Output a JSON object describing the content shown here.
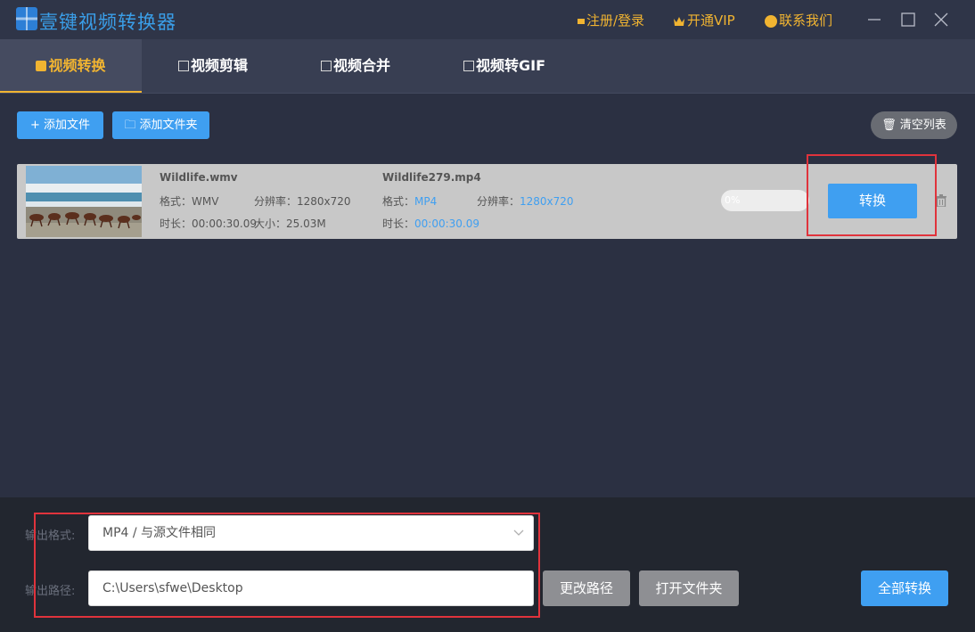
{
  "app": {
    "title": "壹键视频转换器"
  },
  "header": {
    "login": "注册/登录",
    "vip": "开通VIP",
    "contact": "联系我们"
  },
  "tabs": [
    {
      "label": "视频转换",
      "active": true
    },
    {
      "label": "视频剪辑",
      "active": false
    },
    {
      "label": "视频合并",
      "active": false
    },
    {
      "label": "视频转GIF",
      "active": false
    }
  ],
  "toolbar": {
    "add_file": "添加文件",
    "add_folder": "添加文件夹",
    "clear_list": "清空列表"
  },
  "files": [
    {
      "source": {
        "name": "Wildlife.wmv",
        "format_label": "格式：",
        "format": "WMV",
        "resolution_label": "分辨率：",
        "resolution": "1280x720",
        "duration_label": "时长：",
        "duration": "00:00:30.09",
        "size_label": "大小：",
        "size": "25.03M"
      },
      "output": {
        "name": "Wildlife279.mp4",
        "format_label": "格式：",
        "format": "MP4",
        "resolution_label": "分辨率：",
        "resolution": "1280x720",
        "duration_label": "时长：",
        "duration": "00:00:30.09"
      },
      "progress_text": "0%",
      "progress": 0,
      "convert_label": "转换"
    }
  ],
  "bottom": {
    "format_label": "输出格式:",
    "format_value": "MP4 / 与源文件相同",
    "path_label": "输出路径:",
    "path_value": "C:\\Users\\sfwe\\Desktop",
    "change_path": "更改路径",
    "open_folder": "打开文件夹",
    "convert_all": "全部转换"
  },
  "colors": {
    "accent": "#3f9ff1",
    "tab_active": "#f1b431",
    "highlight": "#e0333c"
  }
}
